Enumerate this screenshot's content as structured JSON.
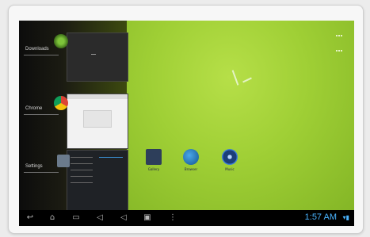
{
  "recents": [
    {
      "label": "Downloads",
      "icon": "download-icon"
    },
    {
      "label": "Chrome",
      "icon": "chrome-icon"
    },
    {
      "label": "Settings",
      "icon": "settings-icon"
    }
  ],
  "desktop": {
    "shortcuts": [
      {
        "label": "Gallery",
        "icon": "gallery-icon"
      },
      {
        "label": "Browser",
        "icon": "globe-icon"
      },
      {
        "label": "Music",
        "icon": "music-icon"
      }
    ],
    "allapps_icon": "apps-grid-icon"
  },
  "navbar": {
    "icons": [
      "back-icon",
      "home-icon",
      "recents-icon",
      "volume-down-icon",
      "volume-up-icon",
      "screenshot-icon",
      "menu-icon"
    ],
    "clock": "1:57 AM",
    "status_icons": [
      "wifi-icon",
      "battery-icon"
    ]
  },
  "colors": {
    "wallpaper": "#9fcf35",
    "clock": "#4ab4ff",
    "navbar": "#000000"
  }
}
